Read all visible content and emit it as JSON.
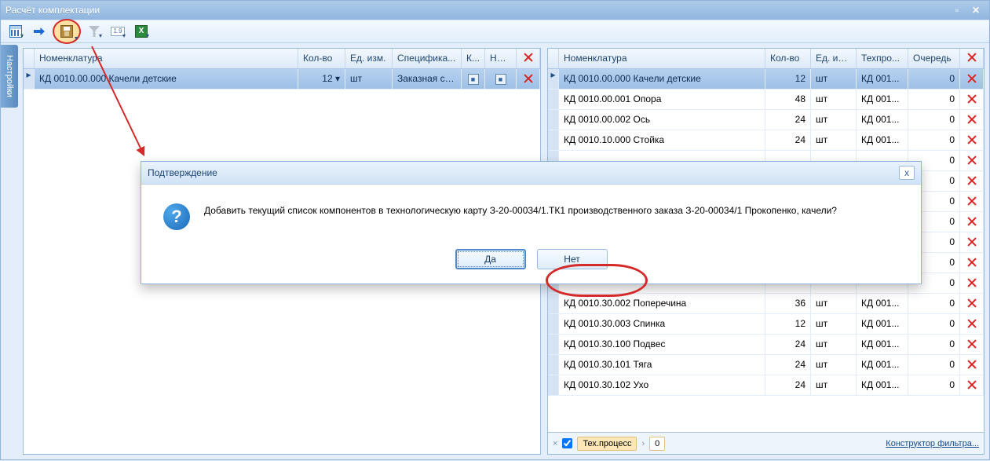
{
  "window": {
    "title": "Расчёт комплектации"
  },
  "sidetab": {
    "label": "Настройки"
  },
  "toolbar": {
    "num_label": "1.9"
  },
  "left_grid": {
    "headers": {
      "item": "Номенклатура",
      "qty": "Кол-во",
      "uom": "Ед. изм.",
      "spec": "Специфика...",
      "k": "К...",
      "nek": "Не к..."
    },
    "rows": [
      {
        "item": "КД 0010.00.000 Качели детские",
        "qty": "12",
        "uom": "шт",
        "spec": "Заказная сп...",
        "k": true,
        "nek": true
      }
    ]
  },
  "right_grid": {
    "headers": {
      "item": "Номенклатура",
      "qty": "Кол-во",
      "uom": "Ед. изм.",
      "tp": "Техпро...",
      "queue": "Очередь"
    },
    "rows": [
      {
        "item": "КД 0010.00.000 Качели детские",
        "qty": "12",
        "uom": "шт",
        "tp": "КД 001...",
        "queue": "0"
      },
      {
        "item": "КД 0010.00.001 Опора",
        "qty": "48",
        "uom": "шт",
        "tp": "КД 001...",
        "queue": "0"
      },
      {
        "item": "КД 0010.00.002 Ось",
        "qty": "24",
        "uom": "шт",
        "tp": "КД 001...",
        "queue": "0"
      },
      {
        "item": "КД 0010.10.000 Стойка",
        "qty": "24",
        "uom": "шт",
        "tp": "КД 001...",
        "queue": "0"
      },
      {
        "item": "",
        "qty": "",
        "uom": "",
        "tp": "",
        "queue": "0"
      },
      {
        "item": "",
        "qty": "",
        "uom": "",
        "tp": "",
        "queue": "0"
      },
      {
        "item": "",
        "qty": "",
        "uom": "",
        "tp": "",
        "queue": "0"
      },
      {
        "item": "",
        "qty": "",
        "uom": "",
        "tp": "",
        "queue": "0"
      },
      {
        "item": "",
        "qty": "",
        "uom": "",
        "tp": "",
        "queue": "0"
      },
      {
        "item": "",
        "qty": "",
        "uom": "",
        "tp": "",
        "queue": "0"
      },
      {
        "item": "",
        "qty": "",
        "uom": "",
        "tp": "",
        "queue": "0"
      },
      {
        "item": "КД 0010.30.002 Поперечина",
        "qty": "36",
        "uom": "шт",
        "tp": "КД 001...",
        "queue": "0"
      },
      {
        "item": "КД 0010.30.003 Спинка",
        "qty": "12",
        "uom": "шт",
        "tp": "КД 001...",
        "queue": "0"
      },
      {
        "item": "КД 0010.30.100 Подвес",
        "qty": "24",
        "uom": "шт",
        "tp": "КД 001...",
        "queue": "0"
      },
      {
        "item": "КД 0010.30.101 Тяга",
        "qty": "24",
        "uom": "шт",
        "tp": "КД 001...",
        "queue": "0"
      },
      {
        "item": "КД 0010.30.102 Ухо",
        "qty": "24",
        "uom": "шт",
        "tp": "КД 001...",
        "queue": "0"
      }
    ]
  },
  "footer": {
    "filter_label": "Тех.процесс",
    "filter_value": "0",
    "link": "Конструктор фильтра..."
  },
  "dialog": {
    "title": "Подтверждение",
    "message": "Добавить текущий список компонентов в технологическую карту З-20-00034/1.ТК1  производственного заказа З-20-00034/1 Прокопенко, качели?",
    "yes": "Да",
    "no": "Нет"
  }
}
